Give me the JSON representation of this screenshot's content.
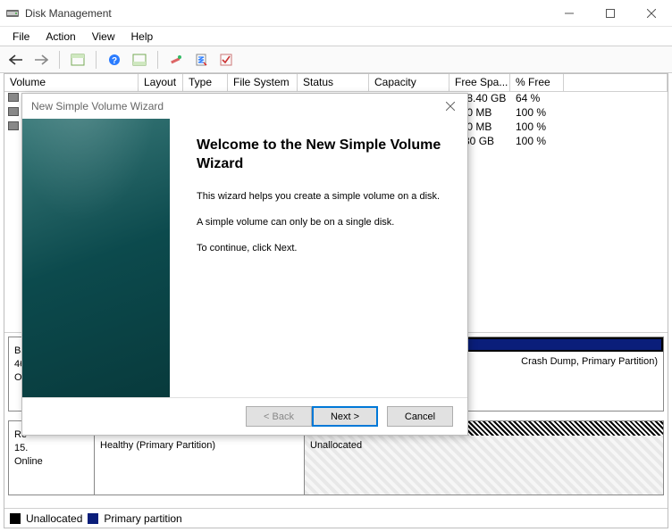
{
  "window": {
    "title": "Disk Management"
  },
  "menu": {
    "items": [
      "File",
      "Action",
      "View",
      "Help"
    ]
  },
  "columns": [
    "Volume",
    "Layout",
    "Type",
    "File System",
    "Status",
    "Capacity",
    "Free Spa...",
    "% Free"
  ],
  "rows": [
    {
      "free": "298.40 GB",
      "pct": "64 %"
    },
    {
      "free": "450 MB",
      "pct": "100 %"
    },
    {
      "free": "100 MB",
      "pct": "100 %"
    },
    {
      "free": "7.80 GB",
      "pct": "100 %"
    }
  ],
  "disk0": {
    "partitions": [
      {
        "tail": "Crash Dump, Primary Partition)"
      }
    ]
  },
  "disk1": {
    "label0_prefix": "Ba",
    "label1_prefix": "46",
    "label2_prefix": "On",
    "status": "Online",
    "size_prefix": "15.",
    "region_prefix": "Re",
    "partitions": [
      {
        "status": "Healthy (Primary Partition)"
      },
      {
        "status": "Unallocated"
      }
    ]
  },
  "legend": {
    "unallocated": "Unallocated",
    "primary": "Primary partition"
  },
  "wizard": {
    "title": "New Simple Volume Wizard",
    "heading": "Welcome to the New Simple Volume Wizard",
    "p1": "This wizard helps you create a simple volume on a disk.",
    "p2": "A simple volume can only be on a single disk.",
    "p3": "To continue, click Next.",
    "back": "< Back",
    "next": "Next >",
    "cancel": "Cancel"
  }
}
